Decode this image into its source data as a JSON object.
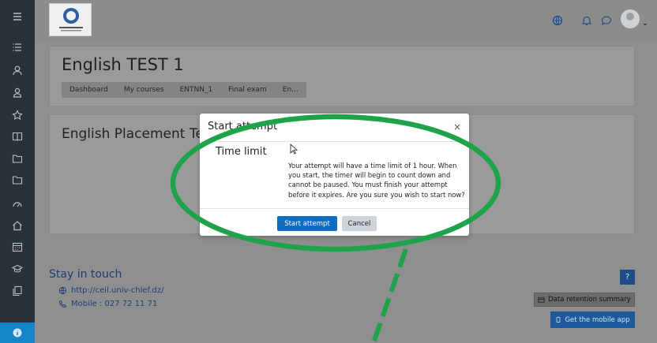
{
  "colors": {
    "accent": "#0f6cbf",
    "annotation": "#1fa34a",
    "sidebar": "#2b3138"
  },
  "page": {
    "title": "English TEST 1",
    "quiz_title": "English Placement Te"
  },
  "breadcrumb": [
    "Dashboard",
    "My courses",
    "ENTNN_1",
    "Final exam",
    "En..."
  ],
  "topbar": {
    "icons": [
      "globe-icon",
      "bell-icon",
      "chat-icon",
      "user-avatar",
      "caret-icon"
    ]
  },
  "sidebar": {
    "icons": [
      "menu-icon",
      "list-icon",
      "user-icon",
      "users-icon",
      "star-icon",
      "book-icon",
      "folder-icon",
      "folder-icon",
      "dashboard-icon",
      "home-icon",
      "calendar-icon",
      "graduation-icon",
      "files-icon",
      "info-icon"
    ]
  },
  "footer": {
    "title": "Stay in touch",
    "website": "http://ceil.univ-chlef.dz/",
    "mobile": "Mobile : 027 72 11 71",
    "data_retention": "Data retention summary",
    "mobile_app": "Get the mobile app",
    "help_label": "?"
  },
  "modal": {
    "title": "Start attempt",
    "close": "×",
    "label": "Time limit",
    "message": "Your attempt will have a time limit of 1 hour. When you start, the timer will begin to count down and cannot be paused. You must finish your attempt before it expires. Are you sure you wish to start now?",
    "start_button": "Start attempt",
    "cancel_button": "Cancel"
  }
}
